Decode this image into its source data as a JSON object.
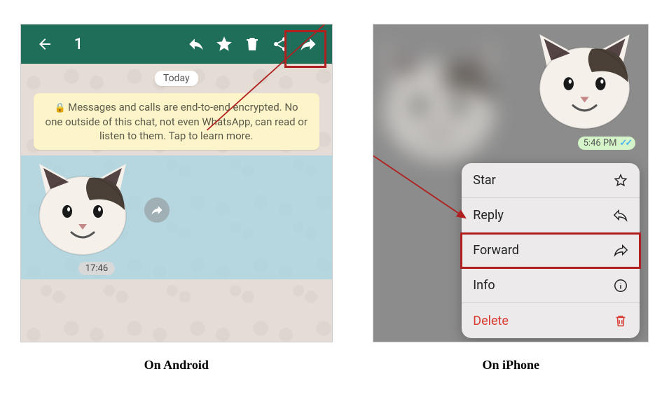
{
  "android": {
    "selection_count": "1",
    "date_pill": "Today",
    "encryption_notice": "Messages and calls are end-to-end encrypted. No one outside of this chat, not even WhatsApp, can read or listen to them. Tap to learn more.",
    "message_time": "17:46"
  },
  "iphone": {
    "message_time": "5:46 PM",
    "menu": {
      "star": "Star",
      "reply": "Reply",
      "forward": "Forward",
      "info": "Info",
      "delete": "Delete"
    }
  },
  "captions": {
    "android": "On Android",
    "iphone": "On iPhone"
  },
  "colors": {
    "whatsapp_green": "#1f6e5a",
    "highlight_red": "#b02020",
    "encryption_bg": "#fdf4c9",
    "selection_blue": "#a6d5e4",
    "ios_delete_red": "#d93a32"
  }
}
